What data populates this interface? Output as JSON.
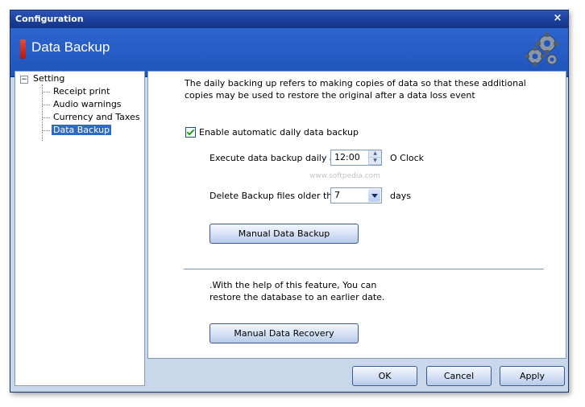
{
  "window": {
    "title": "Configuration",
    "close_glyph": "×"
  },
  "header": {
    "heading": "Data Backup",
    "icon": "gears-icon"
  },
  "tree": {
    "root": "Setting",
    "expander": "−",
    "items": [
      "Receipt print",
      "Audio warnings",
      "Currency and Taxes",
      "Data Backup"
    ],
    "selected_index": 3
  },
  "backup": {
    "description": "The daily backing up refers to making copies of data so that these additional copies may be used to restore the original after a data loss event",
    "enable_label": "Enable automatic daily data backup",
    "enable_checked": true,
    "execute_label": "Execute data backup daily at",
    "time_value": "12:00",
    "time_suffix": "O Clock",
    "delete_label": "Delete Backup files older than",
    "days_value": "7",
    "days_suffix": "days",
    "manual_backup_label": "Manual Data Backup",
    "restore_note": ".With the help of this feature, You can restore the database to an earlier date.",
    "manual_recovery_label": "Manual Data Recovery",
    "watermark": "www.softpedia.com"
  },
  "footer": {
    "ok_label": "OK",
    "cancel_label": "Cancel",
    "apply_label": "Apply"
  },
  "colors": {
    "title_bar": "#1a3f9c",
    "header_band": "#2560c9",
    "selection": "#316ac5",
    "panel_bg": "#c9d7ea"
  }
}
